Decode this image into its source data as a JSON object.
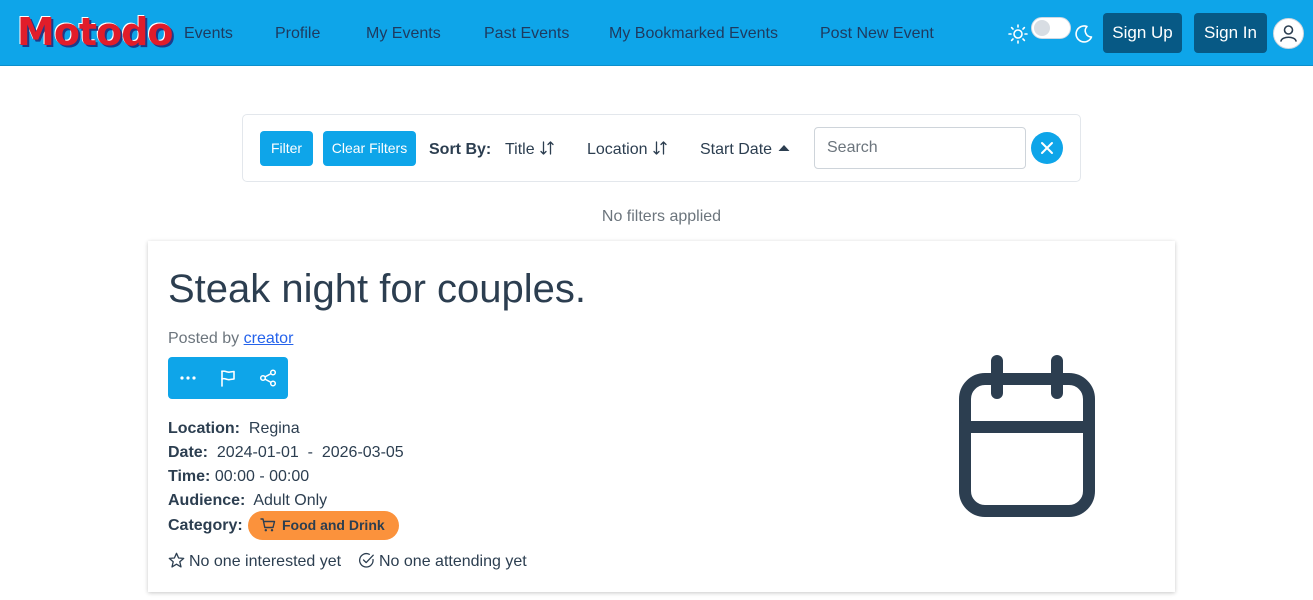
{
  "navbar": {
    "logo": "Motodo",
    "links": [
      "Events",
      "Profile",
      "My Events",
      "Past Events",
      "My Bookmarked Events",
      "Post New Event"
    ],
    "sign_up": "Sign Up",
    "sign_in": "Sign In",
    "theme_icons": [
      "sun-icon",
      "moon-icon"
    ],
    "accent_color": "#0ea5e9"
  },
  "filters": {
    "filter_button": "Filter",
    "clear_button": "Clear Filters",
    "sort_label": "Sort By:",
    "sort_options": [
      "Title",
      "Location",
      "Start Date"
    ],
    "active_sort": "Start Date",
    "search_placeholder": "Search",
    "search_value": "",
    "status": "No filters applied"
  },
  "event": {
    "title": "Steak night for couples.",
    "posted_by_prefix": "Posted by",
    "author": "creator",
    "location_label": "Location:",
    "location": "Regina",
    "date_label": "Date:",
    "date_start": "2024-01-01",
    "date_sep": "-",
    "date_end": "2026-03-05",
    "time_label": "Time:",
    "time": "00:00 - 00:00",
    "audience_label": "Audience:",
    "audience": "Adult Only",
    "category_label": "Category:",
    "category": "Food and Drink",
    "category_color": "#fb923c",
    "interested": "No one interested yet",
    "attending": "No one attending yet"
  }
}
